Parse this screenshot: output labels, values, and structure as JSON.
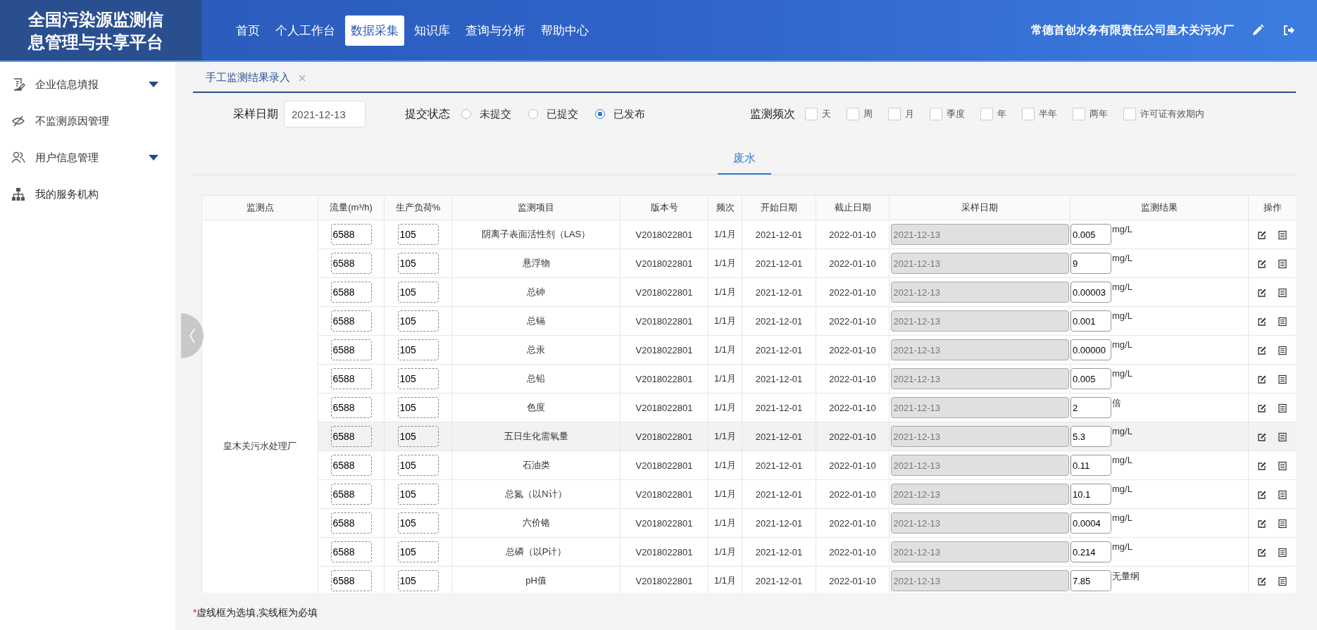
{
  "header": {
    "title": "全国污染源监测信息管理与共享平台",
    "nav": [
      {
        "label": "首页",
        "selected": false
      },
      {
        "label": "个人工作台",
        "selected": false
      },
      {
        "label": "数据采集",
        "selected": true
      },
      {
        "label": "知识库",
        "selected": false
      },
      {
        "label": "查询与分析",
        "selected": false
      },
      {
        "label": "帮助中心",
        "selected": false
      }
    ],
    "company": "常德首创水务有限责任公司皇木关污水厂"
  },
  "sidebar": {
    "items": [
      {
        "label": "企业信息填报",
        "expandable": true
      },
      {
        "label": "不监测原因管理",
        "expandable": false
      },
      {
        "label": "用户信息管理",
        "expandable": true
      },
      {
        "label": "我的服务机构",
        "expandable": false
      }
    ]
  },
  "page_tabs": [
    {
      "label": "手工监测结果录入",
      "selected": true
    }
  ],
  "filters": {
    "sample_date_label": "采样日期",
    "sample_date": "2021-12-13",
    "status_label": "提交状态",
    "status_options": [
      {
        "label": "未提交",
        "selected": false
      },
      {
        "label": "已提交",
        "selected": false
      },
      {
        "label": "已发布",
        "selected": true
      }
    ],
    "frequency_label": "监测频次",
    "frequency_options": [
      {
        "label": "天",
        "checked": false
      },
      {
        "label": "周",
        "checked": false
      },
      {
        "label": "月",
        "checked": false
      },
      {
        "label": "季度",
        "checked": false
      },
      {
        "label": "年",
        "checked": false
      },
      {
        "label": "半年",
        "checked": false
      },
      {
        "label": "两年",
        "checked": false
      },
      {
        "label": "许可证有效期内",
        "checked": false
      }
    ]
  },
  "sub_tabs": [
    {
      "label": "废水",
      "selected": true
    }
  ],
  "table": {
    "columns": [
      "监测点",
      "流量(m³/h)",
      "生产负荷%",
      "监测项目",
      "版本号",
      "频次",
      "开始日期",
      "截止日期",
      "采样日期",
      "监测结果",
      "操作"
    ],
    "site": "皇木关污水处理厂",
    "rows": [
      {
        "flow": "6588",
        "load": "105",
        "item": "阴离子表面活性剂（LAS）",
        "version": "V2018022801",
        "freq": "1/1月",
        "start": "2021-12-01",
        "end": "2022-01-10",
        "sample_date": "2021-12-13",
        "result": "0.005",
        "unit": "mg/L",
        "hovered": false
      },
      {
        "flow": "6588",
        "load": "105",
        "item": "悬浮物",
        "version": "V2018022801",
        "freq": "1/1月",
        "start": "2021-12-01",
        "end": "2022-01-10",
        "sample_date": "2021-12-13",
        "result": "9",
        "unit": "mg/L",
        "hovered": false
      },
      {
        "flow": "6588",
        "load": "105",
        "item": "总砷",
        "version": "V2018022801",
        "freq": "1/1月",
        "start": "2021-12-01",
        "end": "2022-01-10",
        "sample_date": "2021-12-13",
        "result": "0.00003",
        "unit": "mg/L",
        "hovered": false
      },
      {
        "flow": "6588",
        "load": "105",
        "item": "总镉",
        "version": "V2018022801",
        "freq": "1/1月",
        "start": "2021-12-01",
        "end": "2022-01-10",
        "sample_date": "2021-12-13",
        "result": "0.001",
        "unit": "mg/L",
        "hovered": false
      },
      {
        "flow": "6588",
        "load": "105",
        "item": "总汞",
        "version": "V2018022801",
        "freq": "1/1月",
        "start": "2021-12-01",
        "end": "2022-01-10",
        "sample_date": "2021-12-13",
        "result": "0.00000",
        "unit": "mg/L",
        "hovered": false
      },
      {
        "flow": "6588",
        "load": "105",
        "item": "总铅",
        "version": "V2018022801",
        "freq": "1/1月",
        "start": "2021-12-01",
        "end": "2022-01-10",
        "sample_date": "2021-12-13",
        "result": "0.005",
        "unit": "mg/L",
        "hovered": false
      },
      {
        "flow": "6588",
        "load": "105",
        "item": "色度",
        "version": "V2018022801",
        "freq": "1/1月",
        "start": "2021-12-01",
        "end": "2022-01-10",
        "sample_date": "2021-12-13",
        "result": "2",
        "unit": "倍",
        "hovered": false
      },
      {
        "flow": "6588",
        "load": "105",
        "item": "五日生化需氧量",
        "version": "V2018022801",
        "freq": "1/1月",
        "start": "2021-12-01",
        "end": "2022-01-10",
        "sample_date": "2021-12-13",
        "result": "5.3",
        "unit": "mg/L",
        "hovered": true
      },
      {
        "flow": "6588",
        "load": "105",
        "item": "石油类",
        "version": "V2018022801",
        "freq": "1/1月",
        "start": "2021-12-01",
        "end": "2022-01-10",
        "sample_date": "2021-12-13",
        "result": "0.11",
        "unit": "mg/L",
        "hovered": false
      },
      {
        "flow": "6588",
        "load": "105",
        "item": "总氮（以N计）",
        "version": "V2018022801",
        "freq": "1/1月",
        "start": "2021-12-01",
        "end": "2022-01-10",
        "sample_date": "2021-12-13",
        "result": "10.1",
        "unit": "mg/L",
        "hovered": false
      },
      {
        "flow": "6588",
        "load": "105",
        "item": "六价铬",
        "version": "V2018022801",
        "freq": "1/1月",
        "start": "2021-12-01",
        "end": "2022-01-10",
        "sample_date": "2021-12-13",
        "result": "0.0004",
        "unit": "mg/L",
        "hovered": false
      },
      {
        "flow": "6588",
        "load": "105",
        "item": "总磷（以P计）",
        "version": "V2018022801",
        "freq": "1/1月",
        "start": "2021-12-01",
        "end": "2022-01-10",
        "sample_date": "2021-12-13",
        "result": "0.214",
        "unit": "mg/L",
        "hovered": false
      },
      {
        "flow": "6588",
        "load": "105",
        "item": "pH值",
        "version": "V2018022801",
        "freq": "1/1月",
        "start": "2021-12-01",
        "end": "2022-01-10",
        "sample_date": "2021-12-13",
        "result": "7.85",
        "unit": "无量纲",
        "hovered": false
      }
    ]
  },
  "note": {
    "mark": "*",
    "text": "虚线框为选填,实线框为必填"
  }
}
